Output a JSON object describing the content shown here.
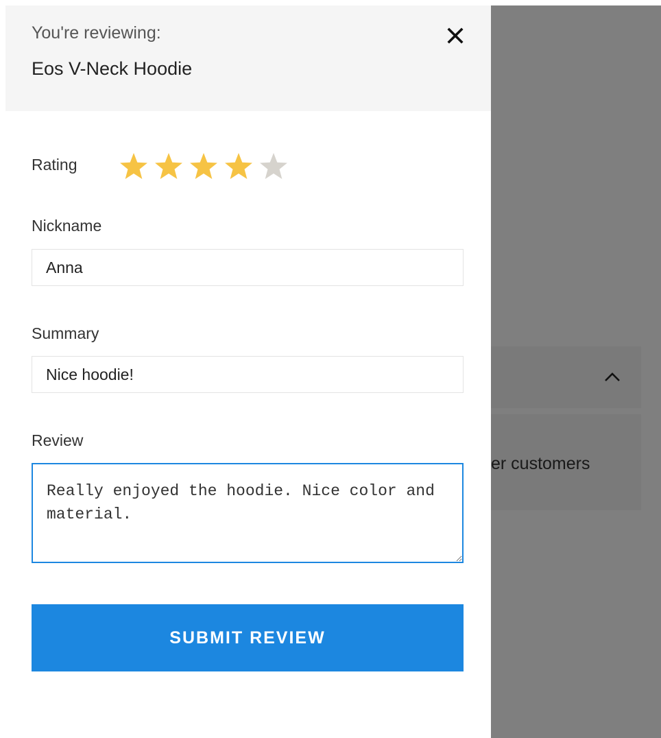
{
  "header": {
    "reviewing_label": "You're reviewing:",
    "product_name": "Eos V-Neck Hoodie"
  },
  "rating": {
    "label": "Rating",
    "value": 4,
    "max": 5,
    "filled_color": "#f6c344",
    "empty_color": "#d6d3cd"
  },
  "form": {
    "nickname": {
      "label": "Nickname",
      "value": "Anna"
    },
    "summary": {
      "label": "Summary",
      "value": "Nice hoodie!"
    },
    "review": {
      "label": "Review",
      "value": "Really enjoyed the hoodie. Nice color and material."
    },
    "submit_label": "SUBMIT REVIEW"
  },
  "background": {
    "partial_text": "er customers"
  },
  "colors": {
    "accent": "#1c87e0",
    "overlay": "rgba(0,0,0,0.5)"
  }
}
